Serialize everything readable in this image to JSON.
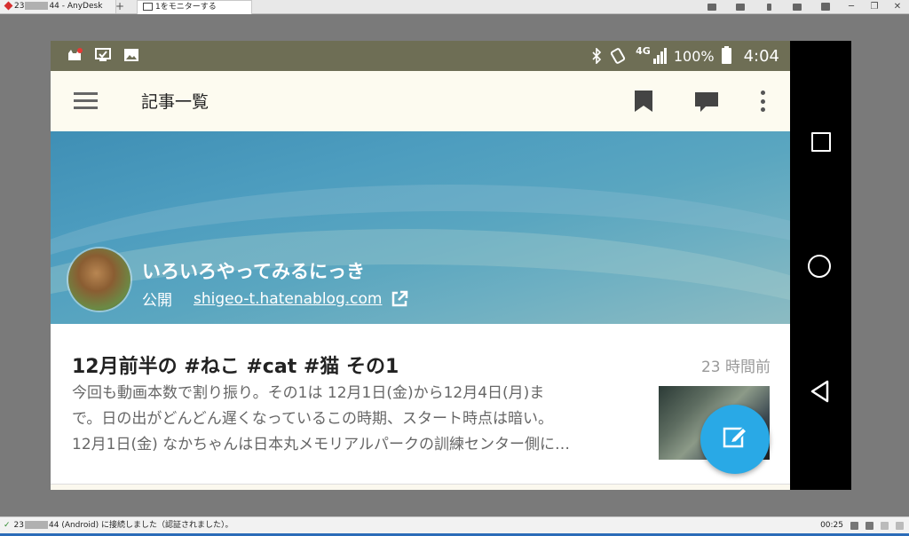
{
  "anydesk": {
    "tab1_prefix": "23",
    "tab1_suffix": "44 - AnyDesk",
    "new_tab": "+",
    "tab2_label": "1をモニターする",
    "status_prefix": "23",
    "status_suffix": "44 (Android) に接続しました（認証されました）。",
    "session_time": "00:25"
  },
  "android": {
    "statusbar": {
      "network": "4G",
      "battery": "100%",
      "time": "4:04"
    },
    "appbar": {
      "title": "記事一覧"
    },
    "blog": {
      "title": "いろいろやってみるにっき",
      "visibility": "公開",
      "url": "shigeo-t.hatenablog.com"
    },
    "article": {
      "title": "12月前半の #ねこ #cat #猫 その1",
      "time_ago": "23 時間前",
      "excerpt_lines": [
        "今回も動画本数で割り振り。その1は 12月1日(金)から12月4日(月)ま",
        "で。日の出がどんどん遅くなっているこの時期、スタート時点は暗い。",
        "12月1日(金) なかちゃんは日本丸メモリアルパークの訓練センター側に…"
      ]
    }
  },
  "colors": {
    "statusbar": "#6e6e55",
    "appbar": "#fdfbf0",
    "fab": "#29a9e6",
    "header": "#4d9dbf"
  }
}
